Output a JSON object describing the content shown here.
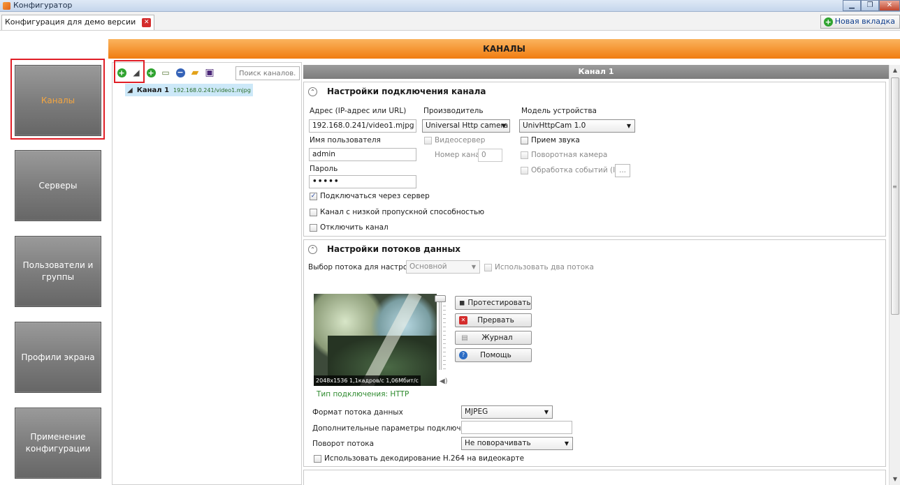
{
  "window": {
    "title": "Конфигуратор"
  },
  "tabs": {
    "document_tab": "Конфигурация для демо версии",
    "new_tab": "Новая вкладка"
  },
  "sidebar": {
    "items": [
      {
        "label": "Каналы",
        "active": true
      },
      {
        "label": "Серверы"
      },
      {
        "label": "Пользователи и группы"
      },
      {
        "label": "Профили экрана"
      },
      {
        "label": "Применение конфигурации"
      }
    ]
  },
  "header": {
    "title": "КАНАЛЫ"
  },
  "channel_list": {
    "search_placeholder": "Поиск каналов...",
    "items": [
      {
        "label": "Канал 1",
        "url": "192.168.0.241/video1.mjpg"
      }
    ]
  },
  "channel_panel": {
    "title": "Канал 1"
  },
  "connection": {
    "title": "Настройки подключения канала",
    "address_label": "Адрес (IP-адрес или URL)",
    "address_value": "192.168.0.241/video1.mjpg",
    "username_label": "Имя пользователя",
    "username_value": "admin",
    "password_label": "Пароль",
    "password_value": "•••••",
    "manufacturer_label": "Производитель",
    "manufacturer_value": "Universal Http camera",
    "videoserver_label": "Видеосервер",
    "channel_number_label": "Номер канала",
    "channel_number_value": "0",
    "model_label": "Модель устройства",
    "model_value": "UnivHttpCam 1.0",
    "sound_label": "Прием звука",
    "ptz_label": "Поворотная камера",
    "events_label": "Обработка событий (I/O)",
    "events_button": "...",
    "via_server_label": "Подключаться через сервер",
    "low_bandwidth_label": "Канал с низкой пропускной способностью",
    "disable_label": "Отключить канал"
  },
  "streams": {
    "title": "Настройки потоков данных",
    "select_label": "Выбор потока для настройки",
    "select_value": "Основной",
    "two_streams_label": "Использовать два потока",
    "preview_stats": "2048x1536  1,1кадров/с  1,06Мбит/с",
    "connection_type": "Тип подключения:  HTTP",
    "buttons": {
      "test": "Протестировать",
      "stop": "Прервать",
      "log": "Журнал",
      "help": "Помощь"
    },
    "format_label": "Формат потока данных",
    "format_value": "MJPEG",
    "extra_params_label": "Дополнительные параметры подключения",
    "extra_params_value": "",
    "rotation_label": "Поворот потока",
    "rotation_value": "Не поворачивать",
    "h264_label": "Использовать декодирование H.264 на видеокарте"
  },
  "colors": {
    "accent": "#f07c10",
    "highlight": "#e01e26",
    "active_text": "#f5a640",
    "status_green": "#2d8a2d"
  }
}
